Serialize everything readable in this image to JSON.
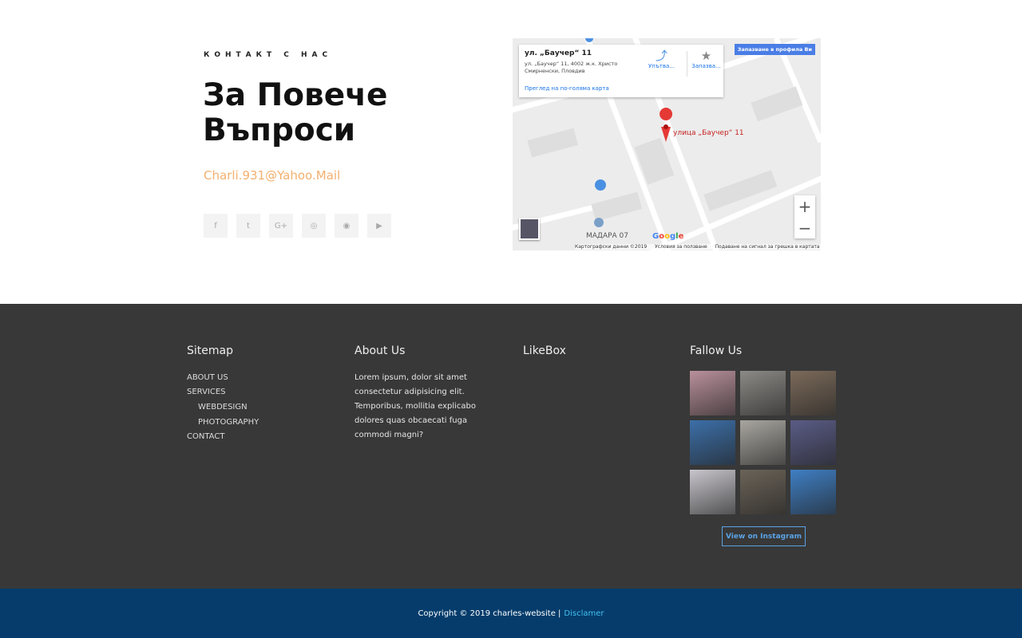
{
  "contact": {
    "eyebrow": "КОНТАКТ С НАС",
    "heading": "За Повече Въпроси",
    "email": "Charli.931@Yahoo.Mail",
    "socials": [
      {
        "icon": "facebook-icon",
        "glyph": "f"
      },
      {
        "icon": "twitter-icon",
        "glyph": "t"
      },
      {
        "icon": "google-plus-icon",
        "glyph": "G+"
      },
      {
        "icon": "instagram-icon",
        "glyph": "◎"
      },
      {
        "icon": "dribbble-icon",
        "glyph": "◉"
      },
      {
        "icon": "youtube-icon",
        "glyph": "▶"
      }
    ]
  },
  "map": {
    "place_title": "ул. „Баучер“ 11",
    "address": "ул. „Баучер“ 11, 4002 ж.к. Христо Смирненски, Пловдив",
    "larger_map": "Преглед на по-голяма карта",
    "directions": "Упътва...",
    "save": "Запазва...",
    "save_profile": "Запазване в профила Ви",
    "pin_label": "улица „Баучер“ 11",
    "poi": "МАДАРА 07",
    "google": "Google",
    "footer_links": [
      "Картографски данни ©2019",
      "Условия за ползване",
      "Подаване на сигнал за грешка в картата"
    ],
    "zoom_in": "+",
    "zoom_out": "−"
  },
  "footer": {
    "sitemap": {
      "title": "Sitemap",
      "items": [
        "ABOUT US",
        "SERVICES",
        "WEBDESIGN",
        "PHOTOGRAPHY",
        "CONTACT"
      ]
    },
    "about": {
      "title": "About Us",
      "text": "Lorem ipsum, dolor sit amet consectetur adipisicing elit. Temporibus, mollitia explicabo dolores quas obcaecati fuga commodi magni?"
    },
    "likebox": {
      "title": "LikeBox"
    },
    "follow": {
      "title": "Fallow Us",
      "photo_colors": [
        "#b9909c",
        "#8c8a86",
        "#7b6a5a",
        "#3c6fa8",
        "#a9a6a0",
        "#5a5c86",
        "#c8c6cc",
        "#6b6358",
        "#3f7fc4"
      ],
      "button": "View on Instagram"
    }
  },
  "copyright": {
    "text": "Copyright © 2019 charles-website |",
    "link": "Disclamer"
  }
}
